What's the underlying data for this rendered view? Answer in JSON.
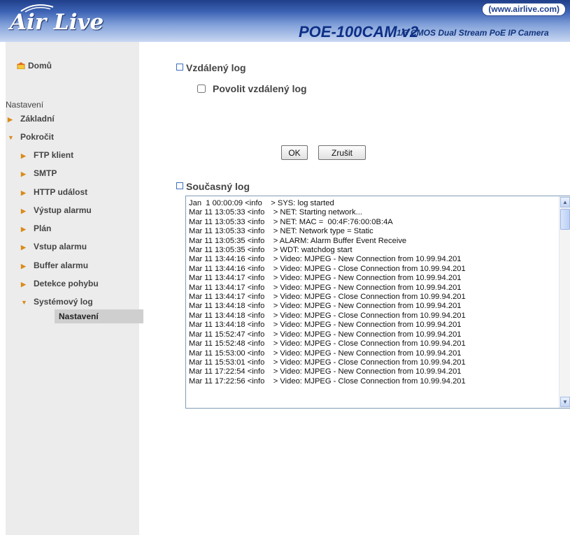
{
  "header": {
    "brand": "Air Live",
    "url_badge": "(www.airlive.com)",
    "model": "POE-100CAM v2",
    "tagline": "1/3 CMOS Dual Stream PoE IP Camera"
  },
  "sidebar": {
    "home_label": "Domů",
    "section_title": "Nastavení",
    "items": [
      {
        "label": "Základní"
      },
      {
        "label": "Pokročit"
      },
      {
        "label": "FTP klient"
      },
      {
        "label": "SMTP"
      },
      {
        "label": "HTTP událost"
      },
      {
        "label": "Výstup alarmu"
      },
      {
        "label": "Plán"
      },
      {
        "label": "Vstup alarmu"
      },
      {
        "label": "Buffer alarmu"
      },
      {
        "label": "Detekce pohybu"
      },
      {
        "label": "Systémový log"
      },
      {
        "label": "Nastavení"
      }
    ]
  },
  "remote_log": {
    "title": "Vzdálený log",
    "enable_label": "Povolit vzdálený log",
    "enable_checked": false
  },
  "buttons": {
    "ok": "OK",
    "cancel": "Zrušit"
  },
  "current_log": {
    "title": "Současný log",
    "lines": [
      "Jan  1 00:00:09 <info    > SYS: log started",
      "Mar 11 13:05:33 <info    > NET: Starting network...",
      "Mar 11 13:05:33 <info    > NET: MAC =  00:4F:76:00:0B:4A",
      "Mar 11 13:05:33 <info    > NET: Network type = Static",
      "Mar 11 13:05:35 <info    > ALARM: Alarm Buffer Event Receive",
      "Mar 11 13:05:35 <info    > WDT: watchdog start",
      "Mar 11 13:44:16 <info    > Video: MJPEG - New Connection from 10.99.94.201",
      "Mar 11 13:44:16 <info    > Video: MJPEG - Close Connection from 10.99.94.201",
      "Mar 11 13:44:17 <info    > Video: MJPEG - New Connection from 10.99.94.201",
      "Mar 11 13:44:17 <info    > Video: MJPEG - New Connection from 10.99.94.201",
      "Mar 11 13:44:17 <info    > Video: MJPEG - Close Connection from 10.99.94.201",
      "Mar 11 13:44:18 <info    > Video: MJPEG - New Connection from 10.99.94.201",
      "Mar 11 13:44:18 <info    > Video: MJPEG - Close Connection from 10.99.94.201",
      "Mar 11 13:44:18 <info    > Video: MJPEG - New Connection from 10.99.94.201",
      "Mar 11 15:52:47 <info    > Video: MJPEG - New Connection from 10.99.94.201",
      "Mar 11 15:52:48 <info    > Video: MJPEG - Close Connection from 10.99.94.201",
      "Mar 11 15:53:00 <info    > Video: MJPEG - New Connection from 10.99.94.201",
      "Mar 11 15:53:01 <info    > Video: MJPEG - Close Connection from 10.99.94.201",
      "Mar 11 17:22:54 <info    > Video: MJPEG - New Connection from 10.99.94.201",
      "Mar 11 17:22:56 <info    > Video: MJPEG - Close Connection from 10.99.94.201"
    ]
  }
}
